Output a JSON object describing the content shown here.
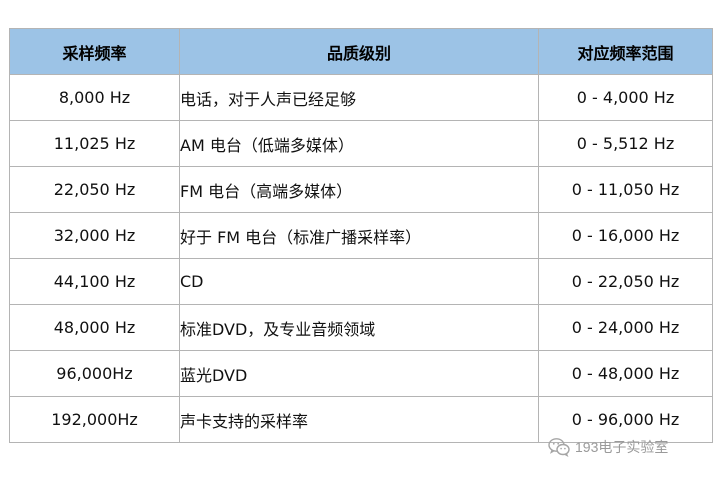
{
  "table": {
    "headers": [
      "采样频率",
      "品质级别",
      "对应频率范围"
    ],
    "rows": [
      [
        "8,000 Hz",
        "电话，对于人声已经足够",
        "0 - 4,000 Hz"
      ],
      [
        "11,025 Hz",
        "AM 电台（低端多媒体）",
        "0 - 5,512 Hz"
      ],
      [
        "22,050 Hz",
        "FM 电台（高端多媒体）",
        "0 - 11,050 Hz"
      ],
      [
        "32,000 Hz",
        "好于 FM 电台（标准广播采样率）",
        "0 - 16,000 Hz"
      ],
      [
        "44,100 Hz",
        "CD",
        "0 - 22,050 Hz"
      ],
      [
        "48,000 Hz",
        "标准DVD，及专业音频领域",
        "0 - 24,000 Hz"
      ],
      [
        "96,000Hz",
        "蓝光DVD",
        "0 - 48,000 Hz"
      ],
      [
        "192,000Hz",
        "声卡支持的采样率",
        "0 - 96,000 Hz"
      ]
    ]
  },
  "watermark": {
    "text": "193电子实验室",
    "icon": "wechat-icon"
  },
  "colors": {
    "header_background": "#9cc3e6",
    "border": "#b4b4b4",
    "watermark": "#9a9a9a"
  }
}
